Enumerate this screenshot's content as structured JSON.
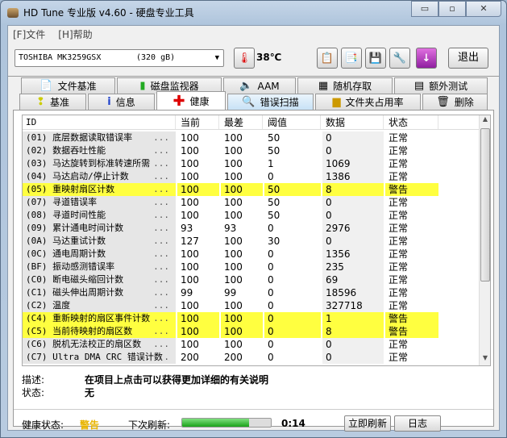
{
  "window": {
    "title": "HD Tune 专业版 v4.60 - 硬盘专业工具",
    "minimize": "▭",
    "maximize": "▫",
    "close": "✕"
  },
  "menu": [
    "[F]文件",
    "[H]帮助"
  ],
  "toolbar": {
    "drive_name": "TOSHIBA MK3259GSX",
    "drive_size": "(320 gB)",
    "temperature": "38℃",
    "exit_label": "退出",
    "icons": [
      "copy-text-icon",
      "copy-screenshot-icon",
      "save-icon",
      "options-icon",
      "download-icon"
    ]
  },
  "tabs_row1": [
    {
      "label": "文件基准",
      "icon": "file-benchmark-icon"
    },
    {
      "label": "磁盘监视器",
      "icon": "disk-monitor-icon"
    },
    {
      "label": "AAM",
      "icon": "speaker-icon"
    },
    {
      "label": "随机存取",
      "icon": "random-access-icon"
    },
    {
      "label": "额外测试",
      "icon": "extra-tests-icon"
    }
  ],
  "tabs_row2": [
    {
      "label": "基准",
      "icon": "benchmark-icon"
    },
    {
      "label": "信息",
      "icon": "info-icon"
    },
    {
      "label": "健康",
      "icon": "health-cross-icon",
      "active": true
    },
    {
      "label": "错误扫描",
      "icon": "magnifier-icon"
    },
    {
      "label": "文件夹占用率",
      "icon": "folder-icon"
    },
    {
      "label": "删除",
      "icon": "trash-icon"
    }
  ],
  "table": {
    "columns": [
      "ID",
      "当前",
      "最差",
      "阈值",
      "数据",
      "状态"
    ],
    "rows": [
      [
        "(01) 底层数据读取错误率",
        "100",
        "100",
        "50",
        "0",
        "正常"
      ],
      [
        "(02) 数据吞吐性能",
        "100",
        "100",
        "50",
        "0",
        "正常"
      ],
      [
        "(03) 马达旋转到标准转速所需",
        "100",
        "100",
        "1",
        "1069",
        "正常"
      ],
      [
        "(04) 马达启动/停止计数",
        "100",
        "100",
        "0",
        "1386",
        "正常"
      ],
      [
        "(05) 重映射扇区计数",
        "100",
        "100",
        "50",
        "8",
        "警告"
      ],
      [
        "(07) 寻道错误率",
        "100",
        "100",
        "50",
        "0",
        "正常"
      ],
      [
        "(08) 寻道时间性能",
        "100",
        "100",
        "50",
        "0",
        "正常"
      ],
      [
        "(09) 累计通电时间计数",
        "93",
        "93",
        "0",
        "2976",
        "正常"
      ],
      [
        "(0A) 马达重试计数",
        "127",
        "100",
        "30",
        "0",
        "正常"
      ],
      [
        "(0C) 通电周期计数",
        "100",
        "100",
        "0",
        "1356",
        "正常"
      ],
      [
        "(BF) 振动感测错误率",
        "100",
        "100",
        "0",
        "235",
        "正常"
      ],
      [
        "(C0) 断电磁头缩回计数",
        "100",
        "100",
        "0",
        "69",
        "正常"
      ],
      [
        "(C1) 磁头伸出周期计数",
        "99",
        "99",
        "0",
        "18596",
        "正常"
      ],
      [
        "(C2) 温度",
        "100",
        "100",
        "0",
        "327718",
        "正常"
      ],
      [
        "(C4) 重新映射的扇区事件计数",
        "100",
        "100",
        "0",
        "1",
        "警告"
      ],
      [
        "(C5) 当前待映射的扇区数",
        "100",
        "100",
        "0",
        "8",
        "警告"
      ],
      [
        "(C6) 脱机无法校正的扇区数",
        "100",
        "100",
        "0",
        "0",
        "正常"
      ],
      [
        "(C7) Ultra DMA CRC 错误计数",
        "200",
        "200",
        "0",
        "0",
        "正常"
      ]
    ],
    "ellipsis": "...",
    "warning_color": "#ffff40"
  },
  "details": {
    "desc_label": "描述:",
    "desc_value": "在项目上点击可以获得更加详细的有关说明",
    "status_label": "状态:",
    "status_value": "无"
  },
  "footer": {
    "health_label": "健康状态:",
    "health_value": "警告",
    "health_color": "#e8b400",
    "refresh_label": "下次刷新:",
    "refresh_progress_percent": 75,
    "countdown": "0:14",
    "refresh_button": "立即刷新",
    "log_button": "日志"
  }
}
